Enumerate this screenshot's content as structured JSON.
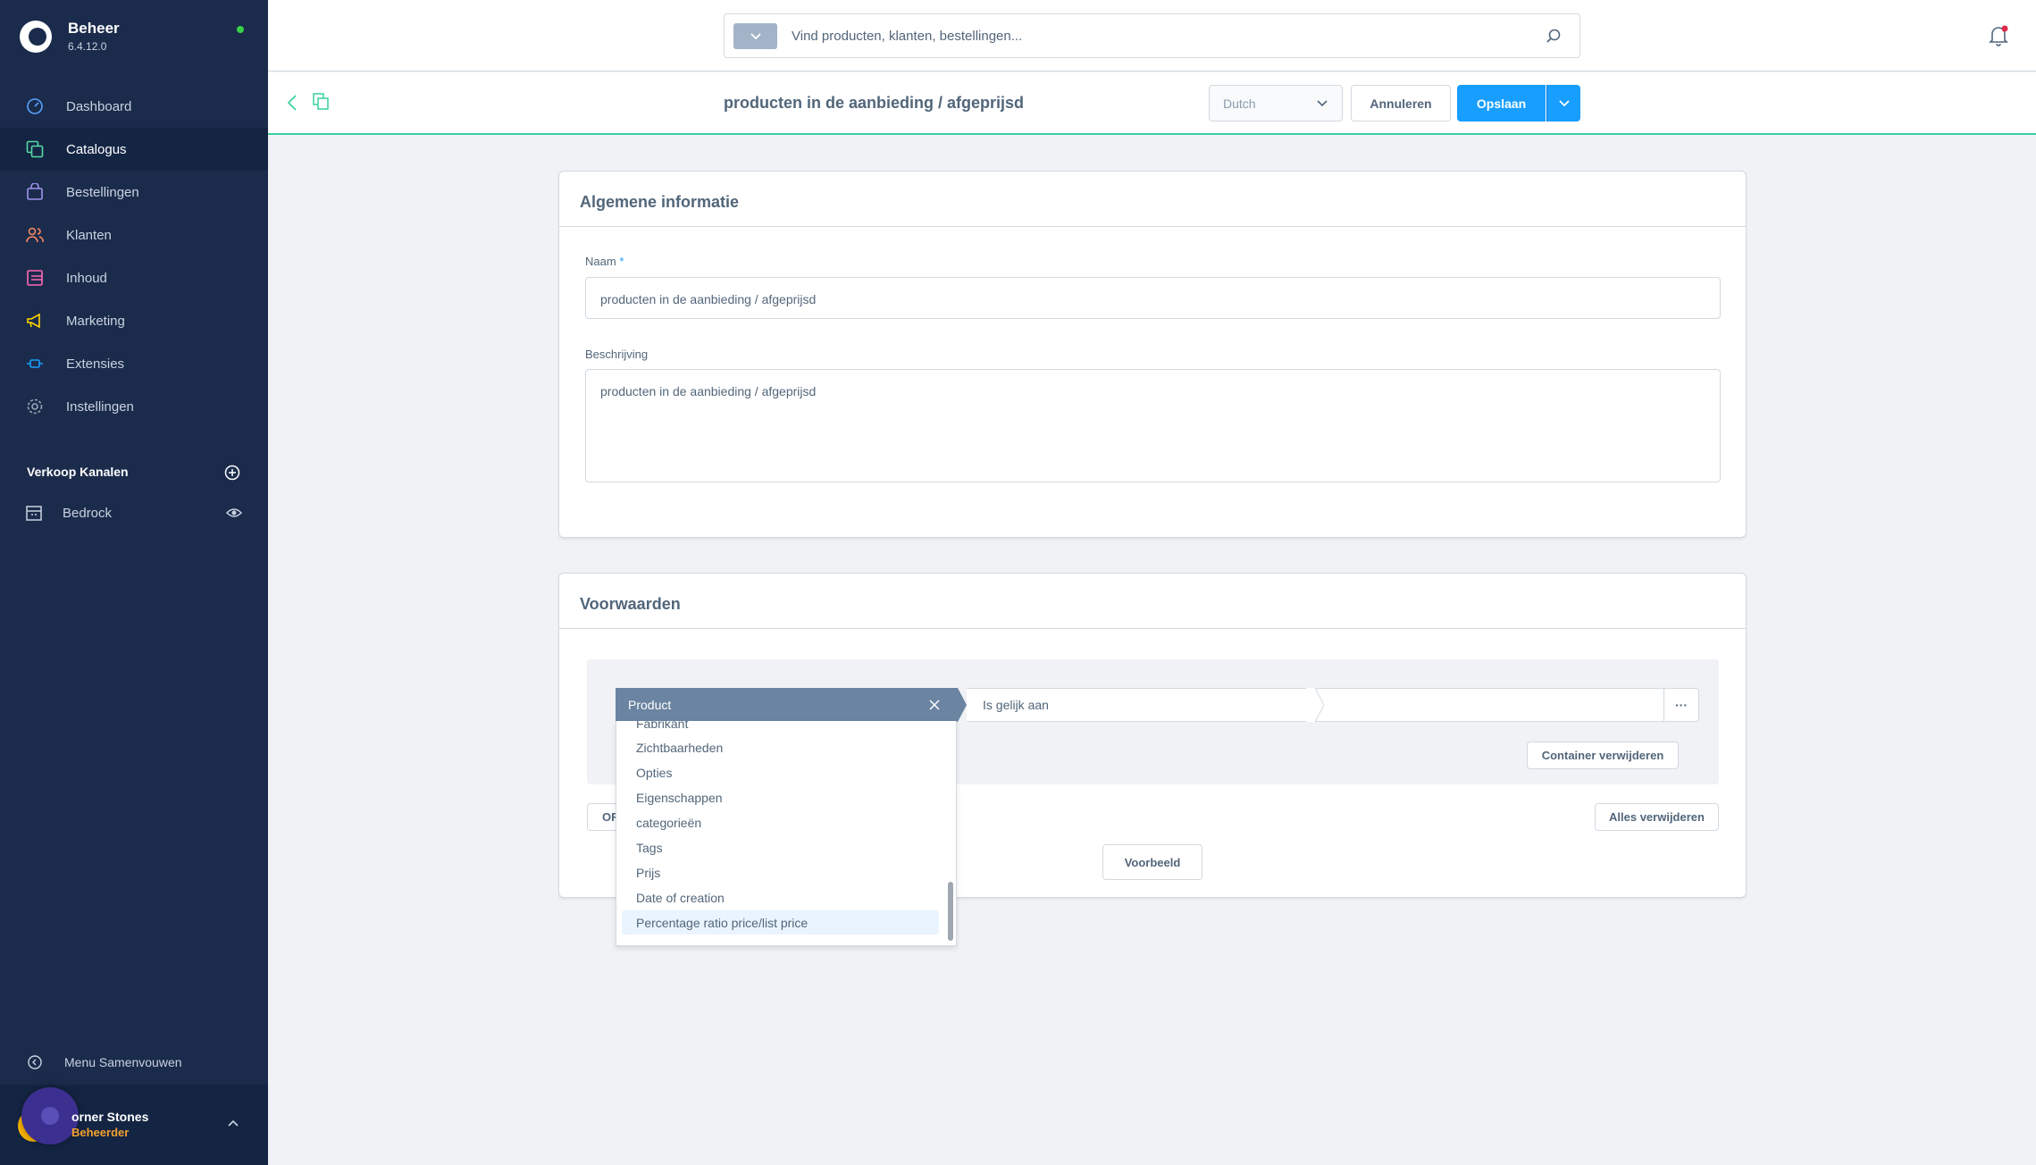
{
  "app": {
    "name": "Beheer",
    "version": "6.4.12.0"
  },
  "nav": [
    {
      "label": "Dashboard",
      "icon": "gauge-icon",
      "color": "#56a4ff"
    },
    {
      "label": "Catalogus",
      "icon": "catalog-icon",
      "color": "#57d9a3"
    },
    {
      "label": "Bestellingen",
      "icon": "bag-icon",
      "color": "#a092f0"
    },
    {
      "label": "Klanten",
      "icon": "users-icon",
      "color": "#f88962"
    },
    {
      "label": "Inhoud",
      "icon": "content-icon",
      "color": "#ff68b4"
    },
    {
      "label": "Marketing",
      "icon": "megaphone-icon",
      "color": "#ffd700"
    },
    {
      "label": "Extensies",
      "icon": "plug-icon",
      "color": "#189eff"
    },
    {
      "label": "Instellingen",
      "icon": "gear-icon",
      "color": "#9aa8b5"
    }
  ],
  "channels": {
    "title": "Verkoop Kanalen",
    "items": [
      {
        "label": "Bedrock"
      }
    ]
  },
  "sidebar_footer": {
    "collapse_label": "Menu Samenvouwen",
    "user_name": "orner Stones",
    "user_role": "Beheerder"
  },
  "search": {
    "placeholder": "Vind producten, klanten, bestellingen..."
  },
  "smartbar": {
    "title": "producten in de aanbieding / afgeprijsd",
    "language": "Dutch",
    "cancel_label": "Annuleren",
    "save_label": "Opslaan"
  },
  "general": {
    "title": "Algemene informatie",
    "name_label": "Naam",
    "name_value": "producten in de aanbieding / afgeprijsd",
    "description_label": "Beschrijving",
    "description_value": "producten in de aanbieding / afgeprijsd"
  },
  "conditions": {
    "title": "Voorwaarden",
    "field": "Product",
    "operator": "Is gelijk aan",
    "more_label": "···",
    "remove_container_label": "Container verwijderen",
    "or_label": "OF",
    "remove_all_label": "Alles verwijderen",
    "preview_label": "Voorbeeld"
  },
  "dropdown": {
    "items": [
      "Fabrikant",
      "Zichtbaarheden",
      "Opties",
      "Eigenschappen",
      "categorieën",
      "Tags",
      "Prijs",
      "Date of creation",
      "Percentage ratio price/list price"
    ],
    "highlighted": "Percentage ratio price/list price"
  }
}
